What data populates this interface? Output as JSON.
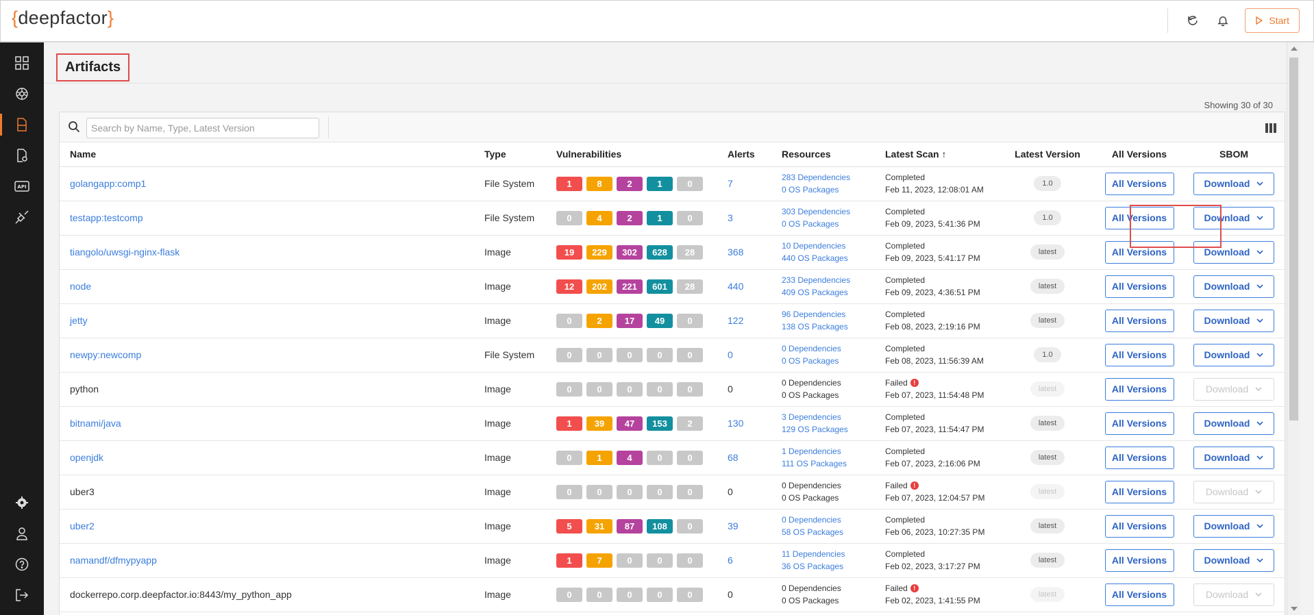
{
  "app": {
    "logo_open": "{",
    "logo_text": "deepfactor",
    "logo_close": "}",
    "start_label": "Start"
  },
  "page": {
    "title": "Artifacts",
    "showing": "Showing 30 of 30"
  },
  "search": {
    "placeholder": "Search by Name, Type, Latest Version"
  },
  "columns": {
    "name": "Name",
    "type": "Type",
    "vulnerabilities": "Vulnerabilities",
    "alerts": "Alerts",
    "resources": "Resources",
    "latest_scan": "Latest Scan",
    "latest_scan_sort": "↑",
    "latest_version": "Latest Version",
    "all_versions": "All Versions",
    "sbom": "SBOM"
  },
  "colors": {
    "critical": "#f24e4e",
    "high": "#f5a300",
    "medium": "#b5439e",
    "low": "#13909f",
    "none": "#c8c8c8",
    "accent": "#f07b2e",
    "link": "#3b7ddd"
  },
  "rows": [
    {
      "name": "golangapp:comp1",
      "link": true,
      "type": "File System",
      "vulns": [
        "1",
        "8",
        "2",
        "1",
        "0"
      ],
      "alerts": "7",
      "deps": "283 Dependencies",
      "os": "0 OS Packages",
      "status": "Completed",
      "failed": false,
      "date": "Feb 11, 2023, 12:08:01 AM",
      "version": "1.0",
      "version_faded": false,
      "all_versions": "All Versions",
      "download": "Download",
      "download_disabled": false
    },
    {
      "name": "testapp:testcomp",
      "link": true,
      "type": "File System",
      "vulns": [
        "0",
        "4",
        "2",
        "1",
        "0"
      ],
      "alerts": "3",
      "deps": "303 Dependencies",
      "os": "0 OS Packages",
      "status": "Completed",
      "failed": false,
      "date": "Feb 09, 2023, 5:41:36 PM",
      "version": "1.0",
      "version_faded": false,
      "all_versions": "All Versions",
      "download": "Download",
      "download_disabled": false
    },
    {
      "name": "tiangolo/uwsgi-nginx-flask",
      "link": true,
      "type": "Image",
      "vulns": [
        "19",
        "229",
        "302",
        "628",
        "28"
      ],
      "alerts": "368",
      "deps": "10 Dependencies",
      "os": "440 OS Packages",
      "status": "Completed",
      "failed": false,
      "date": "Feb 09, 2023, 5:41:17 PM",
      "version": "latest",
      "version_faded": false,
      "all_versions": "All Versions",
      "download": "Download",
      "download_disabled": false
    },
    {
      "name": "node",
      "link": true,
      "type": "Image",
      "vulns": [
        "12",
        "202",
        "221",
        "601",
        "28"
      ],
      "alerts": "440",
      "deps": "233 Dependencies",
      "os": "409 OS Packages",
      "status": "Completed",
      "failed": false,
      "date": "Feb 09, 2023, 4:36:51 PM",
      "version": "latest",
      "version_faded": false,
      "all_versions": "All Versions",
      "download": "Download",
      "download_disabled": false
    },
    {
      "name": "jetty",
      "link": true,
      "type": "Image",
      "vulns": [
        "0",
        "2",
        "17",
        "49",
        "0"
      ],
      "alerts": "122",
      "deps": "96 Dependencies",
      "os": "138 OS Packages",
      "status": "Completed",
      "failed": false,
      "date": "Feb 08, 2023, 2:19:16 PM",
      "version": "latest",
      "version_faded": false,
      "all_versions": "All Versions",
      "download": "Download",
      "download_disabled": false
    },
    {
      "name": "newpy:newcomp",
      "link": true,
      "type": "File System",
      "vulns": [
        "0",
        "0",
        "0",
        "0",
        "0"
      ],
      "alerts": "0",
      "deps": "0 Dependencies",
      "os": "0 OS Packages",
      "status": "Completed",
      "failed": false,
      "date": "Feb 08, 2023, 11:56:39 AM",
      "version": "1.0",
      "version_faded": false,
      "all_versions": "All Versions",
      "download": "Download",
      "download_disabled": false
    },
    {
      "name": "python",
      "link": false,
      "type": "Image",
      "vulns": [
        "0",
        "0",
        "0",
        "0",
        "0"
      ],
      "alerts": "0",
      "deps": "0 Dependencies",
      "os": "0 OS Packages",
      "status": "Failed",
      "failed": true,
      "date": "Feb 07, 2023, 11:54:48 PM",
      "version": "latest",
      "version_faded": true,
      "all_versions": "All Versions",
      "download": "Download",
      "download_disabled": true
    },
    {
      "name": "bitnami/java",
      "link": true,
      "type": "Image",
      "vulns": [
        "1",
        "39",
        "47",
        "153",
        "2"
      ],
      "alerts": "130",
      "deps": "3 Dependencies",
      "os": "129 OS Packages",
      "status": "Completed",
      "failed": false,
      "date": "Feb 07, 2023, 11:54:47 PM",
      "version": "latest",
      "version_faded": false,
      "all_versions": "All Versions",
      "download": "Download",
      "download_disabled": false
    },
    {
      "name": "openjdk",
      "link": true,
      "type": "Image",
      "vulns": [
        "0",
        "1",
        "4",
        "0",
        "0"
      ],
      "alerts": "68",
      "deps": "1 Dependencies",
      "os": "111 OS Packages",
      "status": "Completed",
      "failed": false,
      "date": "Feb 07, 2023, 2:16:06 PM",
      "version": "latest",
      "version_faded": false,
      "all_versions": "All Versions",
      "download": "Download",
      "download_disabled": false
    },
    {
      "name": "uber3",
      "link": false,
      "type": "Image",
      "vulns": [
        "0",
        "0",
        "0",
        "0",
        "0"
      ],
      "alerts": "0",
      "deps": "0 Dependencies",
      "os": "0 OS Packages",
      "status": "Failed",
      "failed": true,
      "date": "Feb 07, 2023, 12:04:57 PM",
      "version": "latest",
      "version_faded": true,
      "all_versions": "All Versions",
      "download": "Download",
      "download_disabled": true
    },
    {
      "name": "uber2",
      "link": true,
      "type": "Image",
      "vulns": [
        "5",
        "31",
        "87",
        "108",
        "0"
      ],
      "alerts": "39",
      "deps": "0 Dependencies",
      "os": "58 OS Packages",
      "status": "Completed",
      "failed": false,
      "date": "Feb 06, 2023, 10:27:35 PM",
      "version": "latest",
      "version_faded": false,
      "all_versions": "All Versions",
      "download": "Download",
      "download_disabled": false
    },
    {
      "name": "namandf/dfmypyapp",
      "link": true,
      "type": "Image",
      "vulns": [
        "1",
        "7",
        "0",
        "0",
        "0"
      ],
      "alerts": "6",
      "deps": "11 Dependencies",
      "os": "36 OS Packages",
      "status": "Completed",
      "failed": false,
      "date": "Feb 02, 2023, 3:17:27 PM",
      "version": "latest",
      "version_faded": false,
      "all_versions": "All Versions",
      "download": "Download",
      "download_disabled": false
    },
    {
      "name": "dockerrepo.corp.deepfactor.io:8443/my_python_app",
      "link": false,
      "type": "Image",
      "vulns": [
        "0",
        "0",
        "0",
        "0",
        "0"
      ],
      "alerts": "0",
      "deps": "0 Dependencies",
      "os": "0 OS Packages",
      "status": "Failed",
      "failed": true,
      "date": "Feb 02, 2023, 1:41:55 PM",
      "version": "latest",
      "version_faded": true,
      "all_versions": "All Versions",
      "download": "Download",
      "download_disabled": true
    }
  ]
}
